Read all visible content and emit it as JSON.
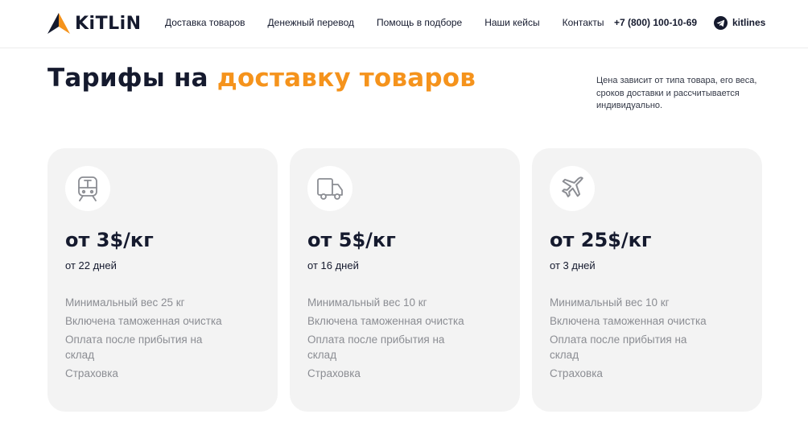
{
  "brand": {
    "name": "KiTLiN",
    "accent": "#f5931c",
    "dark": "#151a2e"
  },
  "nav": {
    "items": [
      {
        "label": "Доставка товаров"
      },
      {
        "label": "Денежный перевод"
      },
      {
        "label": "Помощь в подборе"
      },
      {
        "label": "Наши кейсы"
      },
      {
        "label": "Контакты"
      }
    ],
    "phone": "+7 (800) 100-10-69",
    "telegram": {
      "icon": "telegram-icon",
      "label": "kitlines"
    }
  },
  "hero": {
    "title_main": "Тарифы на ",
    "title_accent": "доставку товаров",
    "note": "Цена зависит от типа товара, его веса, сроков доставки и рассчитывается индивидуально."
  },
  "tariffs": [
    {
      "icon": "train-icon",
      "price": "от 3$/кг",
      "days": "от 22 дней",
      "features": [
        "Минимальный вес 25 кг",
        "Включена таможенная очистка",
        "Оплата после прибытия на склад",
        "Страховка"
      ]
    },
    {
      "icon": "truck-icon",
      "price": "от 5$/кг",
      "days": "от 16 дней",
      "features": [
        "Минимальный вес 10 кг",
        "Включена таможенная очистка",
        "Оплата после прибытия на склад",
        "Страховка"
      ]
    },
    {
      "icon": "plane-icon",
      "price": "от 25$/кг",
      "days": "от 3 дней",
      "features": [
        "Минимальный вес 10 кг",
        "Включена таможенная очистка",
        "Оплата после прибытия на склад",
        "Страховка"
      ]
    }
  ]
}
